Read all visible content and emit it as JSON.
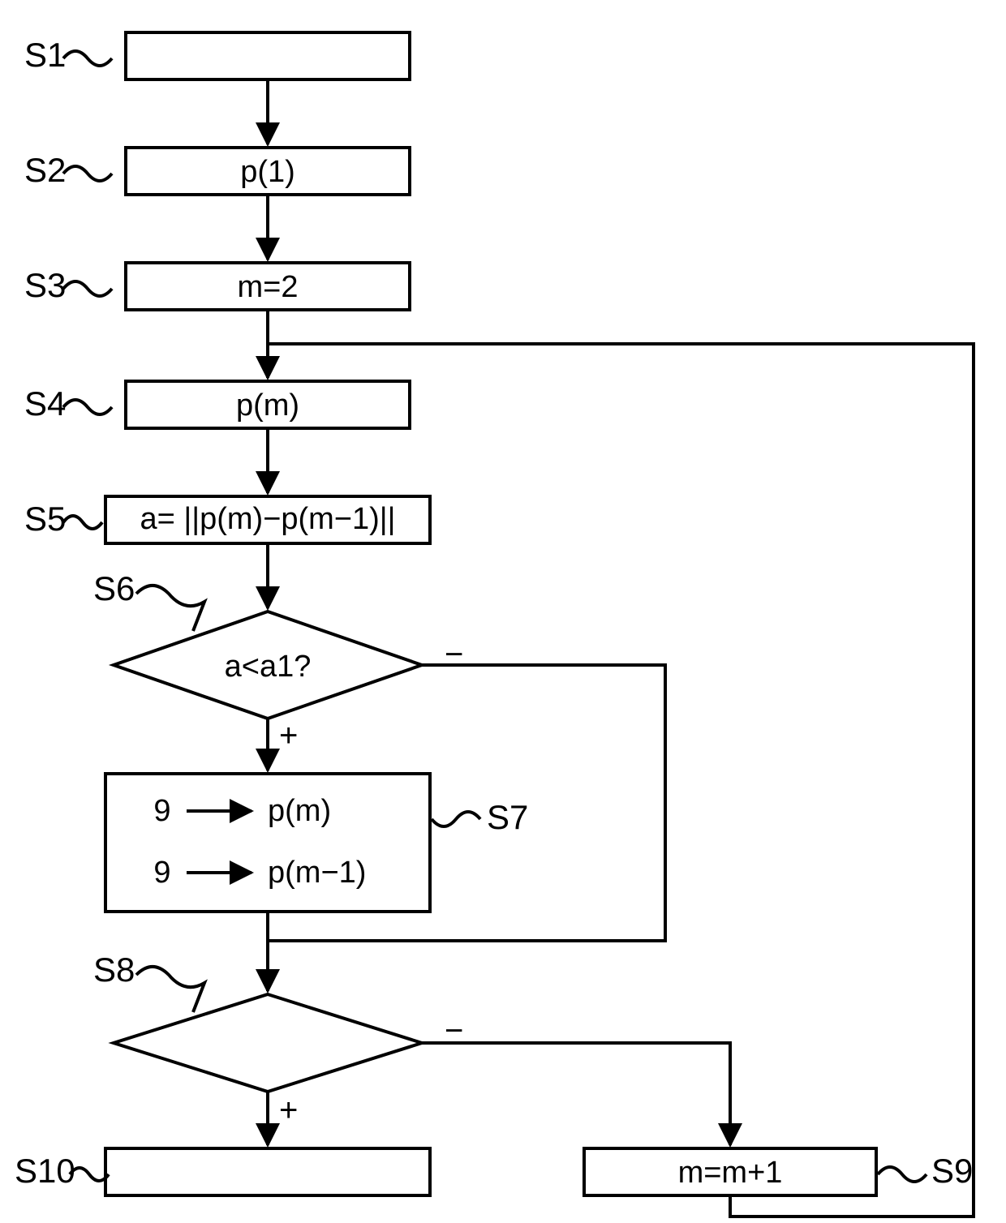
{
  "labels": {
    "s1": "S1",
    "s2": "S2",
    "s3": "S3",
    "s4": "S4",
    "s5": "S5",
    "s6": "S6",
    "s7": "S7",
    "s8": "S8",
    "s9": "S9",
    "s10": "S10"
  },
  "box": {
    "s2": "p(1)",
    "s3": "m=2",
    "s4": "p(m)",
    "s5": "a= ||p(m)−p(m−1)||",
    "s6": "a<a1?",
    "s7a_left": "9",
    "s7a_right": "p(m)",
    "s7b_left": "9",
    "s7b_right": "p(m−1)",
    "s9": "m=m+1"
  },
  "branch": {
    "plus": "+",
    "minus": "−"
  }
}
